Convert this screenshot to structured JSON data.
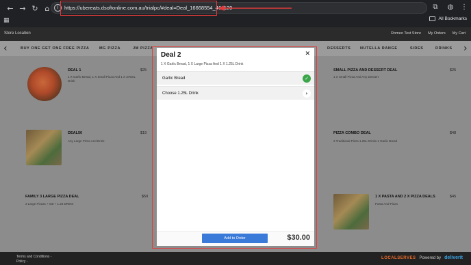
{
  "browser": {
    "url": "https://ubereats.dsoftonline.com.au/trialpc/#deal=Deal_16668554_461129",
    "bookmarks_label": "All Bookmarks"
  },
  "header": {
    "store_location": "Store Location",
    "links": [
      "Romeo Test Store",
      "My Orders",
      "My Cart"
    ]
  },
  "categories": [
    "BUY ONE GET ONE FREE PIZZA",
    "MG PIZZA",
    "JM PIZZA",
    "DESSERTS",
    "NUTELLA RANGE",
    "SIDES",
    "DRINKS"
  ],
  "menu": {
    "items": [
      {
        "title": "DEAL 1",
        "desc": "1 X Garlic Bread, 1 X Small Pizza And 1 X 375mL Drink",
        "price": "$25"
      },
      {
        "title": "DEAL50",
        "desc": "Any Large Pizza And Drink",
        "price": "$19"
      },
      {
        "title": "FAMILY 3 LARGE PIZZA DEAL",
        "desc": "3 Large Pizzas + GB + 1.25 DRINK",
        "price": "$50"
      },
      {
        "title": "SMALL PIZZA AND DESSERT DEAL",
        "desc": "1 X Small Pizza And Any Dessert",
        "price": "$25"
      },
      {
        "title": "PIZZA COMBO DEAL",
        "desc": "2 Traditional Pizza 1.25L Drinks 1 Garlic Bread",
        "price": "$48"
      },
      {
        "title": "1 X PASTA AND 2 X PIZZA DEALS",
        "desc": "Pasta And Pizza",
        "price": "$45"
      }
    ]
  },
  "modal": {
    "title": "Deal 2",
    "subtitle": "1 X Garlic Bread, 1 X Large Pizza And 1 X 1.25L Drink",
    "options": [
      {
        "label": "Garlic Bread",
        "state": "selected"
      },
      {
        "label": "Choose 1.25L Drink",
        "state": "pending"
      }
    ],
    "add_button": "Add to Order",
    "total": "$30.00"
  },
  "footer": {
    "links": [
      "Terms and Conditions -",
      "Policy -"
    ],
    "brand_left": "LOCALSERVES",
    "powered_by": "Powered by",
    "brand_right": "deliverit"
  },
  "colors": {
    "annotation": "#e23b3b",
    "accent": "#3a7ad9",
    "success": "#3aa649"
  }
}
